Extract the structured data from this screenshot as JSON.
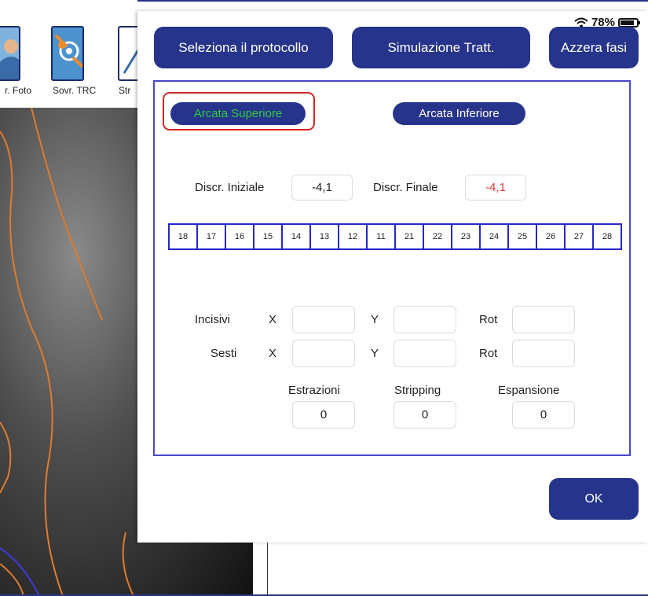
{
  "toolbar": {
    "items": [
      {
        "label": "r. Foto",
        "icon": "person-photo-icon"
      },
      {
        "label": "Sovr. TRC",
        "icon": "trc-overlay-icon"
      },
      {
        "label": "Str",
        "icon": "tool-icon"
      }
    ]
  },
  "status": {
    "battery_text": "78%"
  },
  "modal": {
    "buttons": {
      "protocol": "Seleziona il protocollo",
      "simulation": "Simulazione Tratt.",
      "reset": "Azzera fasi",
      "ok": "OK"
    },
    "arches": {
      "upper": "Arcata Superiore",
      "lower": "Arcata Inferiore",
      "upper_text_color": "#2ecc40"
    },
    "discrepancy": {
      "initial_label": "Discr. Iniziale",
      "initial_value": "-4,1",
      "final_label": "Discr. Finale",
      "final_value": "-4,1",
      "final_color": "#e53935"
    },
    "teeth": [
      "18",
      "17",
      "16",
      "15",
      "14",
      "13",
      "12",
      "11",
      "21",
      "22",
      "23",
      "24",
      "25",
      "26",
      "27",
      "28"
    ],
    "movements": {
      "incisivi_label": "Incisivi",
      "sesti_label": "Sesti",
      "x_label": "X",
      "y_label": "Y",
      "rot_label": "Rot"
    },
    "counters": {
      "extractions_label": "Estrazioni",
      "extractions_value": "0",
      "stripping_label": "Stripping",
      "stripping_value": "0",
      "expansion_label": "Espansione",
      "expansion_value": "0"
    }
  },
  "colors": {
    "primary": "#27348b",
    "panel_border": "#4848c8",
    "highlight": "#d42626"
  }
}
